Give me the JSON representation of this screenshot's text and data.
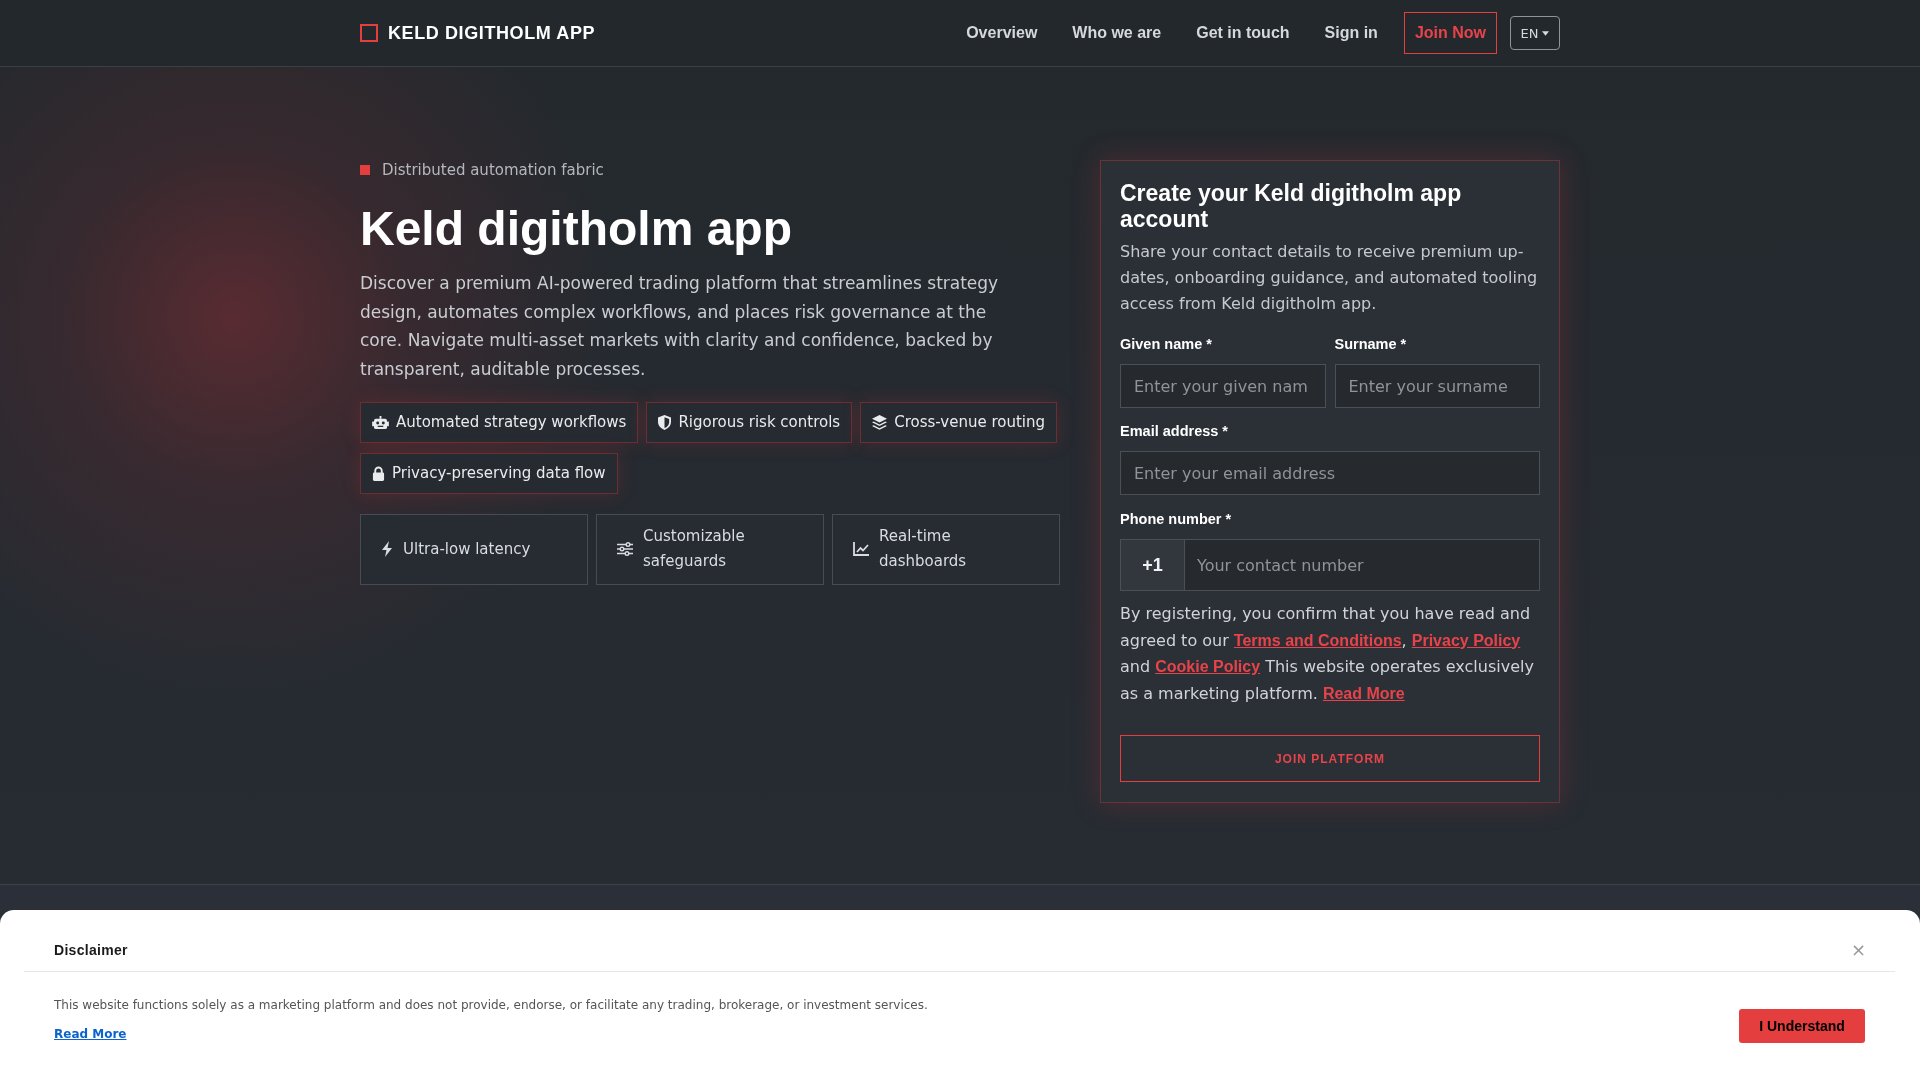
{
  "header": {
    "logo": "KELD DIGITHOLM APP",
    "nav": [
      {
        "label": "Overview",
        "kind": "link"
      },
      {
        "label": "Who we are",
        "kind": "link"
      },
      {
        "label": "Get in touch",
        "kind": "link"
      },
      {
        "label": "Sign in",
        "kind": "link"
      },
      {
        "label": "Join Now",
        "kind": "cta"
      }
    ],
    "language": "EN"
  },
  "hero": {
    "eyebrow": "Distributed automation fabric",
    "title": "Keld digitholm app",
    "description": "Discover a premium AI-powered trading platform that streamlines strategy design, automates complex workflows, and places risk governance at the core. Navigate multi-asset markets with clarity and confidence, backed by transparent, auditable processes.",
    "highlights": [
      "Automated strategy workflows",
      "Rigorous risk controls",
      "Cross-venue routing",
      "Privacy-preserving data flow"
    ],
    "features": [
      "Ultra-low latency",
      "Customizable safeguards",
      "Real-time dashboards"
    ]
  },
  "signup_form": {
    "title": "Create your Keld digitholm app account",
    "description": "Share your contact details to receive premium up-dates, onboarding guidance, and automated tooling access from Keld digitholm app.",
    "name_fields": [
      {
        "label": "Given name *",
        "placeholder": "Enter your given nam"
      },
      {
        "label": "Surname *",
        "placeholder": "Enter your surname"
      }
    ],
    "email_field": {
      "label": "Email address *",
      "placeholder": "Enter your email address"
    },
    "phone_field": {
      "label": "Phone number *",
      "prefix": "+1",
      "placeholder": "Your contact number"
    },
    "consent": [
      {
        "kind": "text",
        "text": "By registering, you confirm that you have read and agreed to our "
      },
      {
        "kind": "link",
        "text": "Terms and Conditions"
      },
      {
        "kind": "text",
        "text": ", "
      },
      {
        "kind": "link",
        "text": "Privacy Policy"
      },
      {
        "kind": "text",
        "text": " and "
      },
      {
        "kind": "link",
        "text": "Cookie Policy"
      },
      {
        "kind": "text",
        "text": " This website operates exclusively as a marketing platform. "
      },
      {
        "kind": "link",
        "text": "Read More"
      }
    ],
    "submit": "JOIN PLATFORM"
  },
  "disclaimer": {
    "title": "Disclaimer",
    "close": "×",
    "text": "This website functions solely as a marketing platform and does not provide, endorse, or facilitate any trading, brokerage, or investment services.",
    "link": "Read More",
    "button": "I Understand"
  }
}
